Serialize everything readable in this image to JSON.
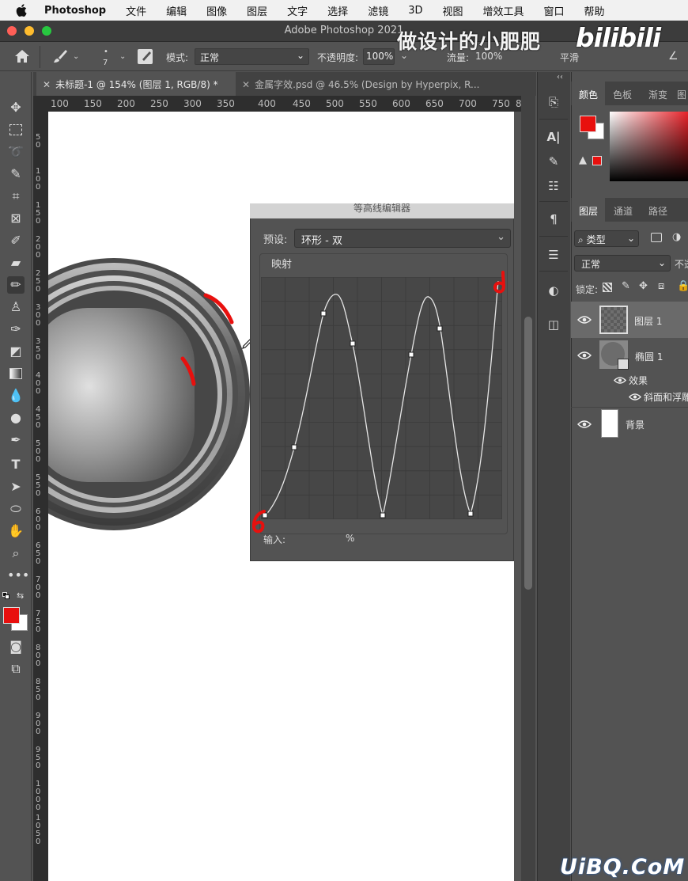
{
  "menubar": {
    "app_name": "Photoshop",
    "items": [
      "文件",
      "编辑",
      "图像",
      "图层",
      "文字",
      "选择",
      "滤镜",
      "3D",
      "视图",
      "增效工具",
      "窗口",
      "帮助"
    ]
  },
  "titlebar": {
    "title": "Adobe Photoshop 2021"
  },
  "watermark": {
    "top_text": "做设计的小肥肥",
    "logo": "bilibili",
    "bottom_text": "UiBQ.CoM"
  },
  "options": {
    "brush_size": "7",
    "mode_label": "模式:",
    "mode_value": "正常",
    "opacity_label": "不透明度:",
    "opacity_value": "100%",
    "flow_label": "流量:",
    "flow_value": "100%",
    "smoothing_label": "平滑"
  },
  "tabs": [
    {
      "label": "未标题-1 @ 154% (图层 1, RGB/8) *",
      "active": true
    },
    {
      "label": "金属字效.psd @ 46.5% (Design by Hyperpix, R...",
      "active": false
    }
  ],
  "ruler": {
    "top_labels": [
      "100",
      "150",
      "200",
      "250",
      "300",
      "350",
      "400",
      "450",
      "500",
      "550",
      "600",
      "650",
      "700",
      "750",
      "8"
    ],
    "left_labels": [
      "5\n0",
      "1\n0\n0",
      "1\n5\n0",
      "2\n0\n0",
      "2\n5\n0",
      "3\n0\n0",
      "3\n5\n0",
      "4\n0\n0",
      "4\n5\n0",
      "5\n0\n0",
      "5\n5\n0",
      "6\n0\n0",
      "6\n5\n0",
      "7\n0\n0",
      "7\n5\n0",
      "8\n0\n0",
      "8\n5\n0",
      "9\n0\n0",
      "9\n5\n0",
      "1\n0\n0\n0",
      "1\n0\n5\n0"
    ]
  },
  "contour_dialog": {
    "title": "等高线编辑器",
    "preset_label": "预设:",
    "preset_value": "环形 - 双",
    "mapping_label": "映射",
    "input_label": "输入:",
    "input_percent": "%"
  },
  "right_panel": {
    "color_tabs": [
      "颜色",
      "色板",
      "渐变",
      "图"
    ],
    "layer_tabs": [
      "图层",
      "通道",
      "路径"
    ],
    "kind_filter": "类型",
    "blend_mode": "正常",
    "opacity_short": "不透",
    "lock_label": "锁定:",
    "layers": [
      {
        "name": "图层 1"
      },
      {
        "name": "椭圆 1"
      },
      {
        "name": "效果"
      },
      {
        "name": "斜面和浮雕"
      },
      {
        "name": "背景"
      }
    ]
  },
  "colors": {
    "foreground": "#e8100e",
    "background": "#ffffff",
    "annotation_red": "#e8100e"
  },
  "icons": [
    "apple-icon",
    "home-icon",
    "brush-icon",
    "move-icon",
    "marquee-icon",
    "lasso-icon",
    "quick-select-icon",
    "crop-icon",
    "frame-icon",
    "eyedropper-icon",
    "healing-icon",
    "brush-tool-icon",
    "stamp-icon",
    "history-brush-icon",
    "eraser-icon",
    "gradient-icon",
    "blur-icon",
    "dodge-icon",
    "pen-icon",
    "type-icon",
    "path-select-icon",
    "ellipse-icon",
    "hand-icon",
    "zoom-icon",
    "more-icon"
  ]
}
